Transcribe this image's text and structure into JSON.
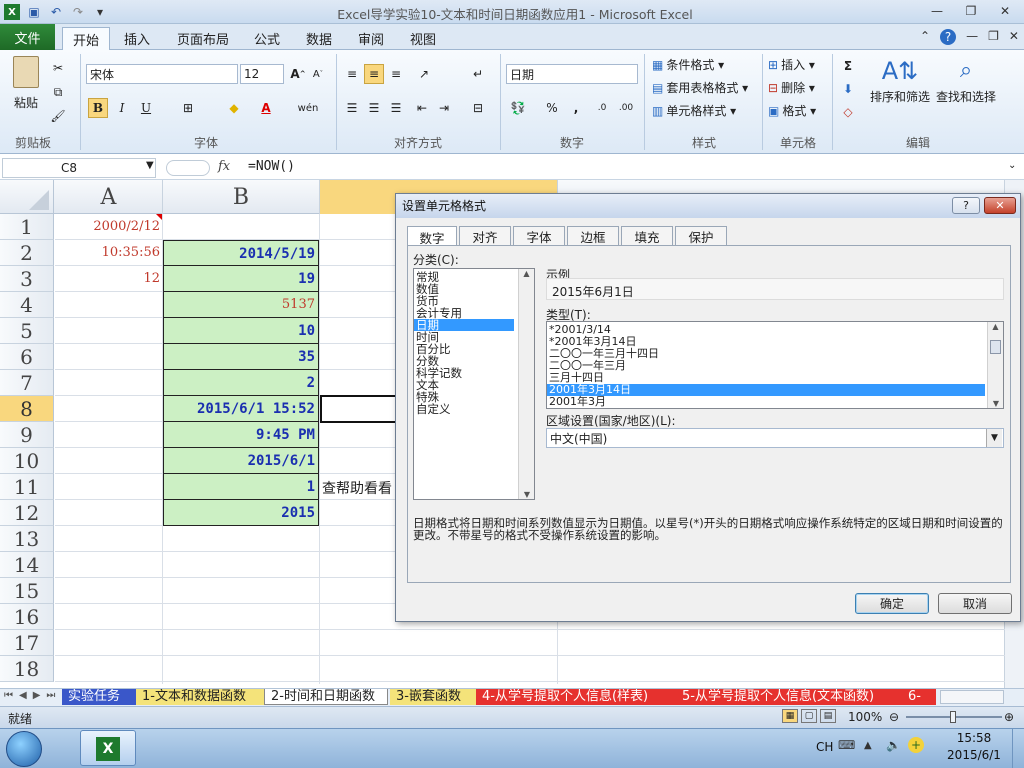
{
  "title_bar": {
    "title": "Excel导学实验10-文本和时间日期函数应用1  -  Microsoft Excel",
    "window_controls": [
      "minimize-icon",
      "restore-icon",
      "close-icon"
    ]
  },
  "ribbon_tabs": {
    "file": "文件",
    "tabs": [
      "开始",
      "插入",
      "页面布局",
      "公式",
      "数据",
      "审阅",
      "视图"
    ],
    "active": "开始"
  },
  "ribbon": {
    "clipboard": {
      "paste": "粘贴",
      "label": "剪贴板"
    },
    "font": {
      "name": "宋体",
      "size": "12",
      "bold": "B",
      "italic": "I",
      "underline": "U",
      "label": "字体"
    },
    "alignment": {
      "label": "对齐方式"
    },
    "number": {
      "format": "日期",
      "percent": "%",
      "comma": ",",
      "label": "数字"
    },
    "styles": {
      "conditional": "条件格式",
      "table": "套用表格格式",
      "cell_styles": "单元格样式",
      "label": "样式"
    },
    "cells": {
      "insert": "插入",
      "delete": "删除",
      "format": "格式",
      "label": "单元格"
    },
    "editing": {
      "sort_filter": "排序和筛选",
      "find_select": "查找和选择",
      "label": "编辑"
    }
  },
  "formula_bar": {
    "name_box": "C8",
    "fx": "fx",
    "formula": "=NOW()"
  },
  "columns": [
    "A",
    "B"
  ],
  "rows": [
    "1",
    "2",
    "3",
    "4",
    "5",
    "6",
    "7",
    "8",
    "9",
    "10",
    "11",
    "12",
    "13",
    "14",
    "15",
    "16",
    "17",
    "18"
  ],
  "selected_row": "8",
  "col_a": [
    "2000/2/12",
    "10:35:56",
    "12"
  ],
  "col_b": [
    "2014/5/19",
    "19",
    "5137",
    "10",
    "35",
    "2",
    "2015/6/1 15:52",
    "9:45 PM",
    "2015/6/1",
    "1",
    "2015"
  ],
  "overflow_text": "查帮助看看",
  "dialog": {
    "title": "设置单元格格式",
    "help": "?",
    "tabs": [
      "数字",
      "对齐",
      "字体",
      "边框",
      "填充",
      "保护"
    ],
    "active_tab": "数字",
    "category_label": "分类(C):",
    "categories": [
      "常规",
      "数值",
      "货币",
      "会计专用",
      "日期",
      "时间",
      "百分比",
      "分数",
      "科学记数",
      "文本",
      "特殊",
      "自定义"
    ],
    "selected_category": "日期",
    "sample_label": "示例",
    "sample_value": "2015年6月1日",
    "type_label": "类型(T):",
    "types": [
      "*2001/3/14",
      "*2001年3月14日",
      "二〇〇一年三月十四日",
      "二〇〇一年三月",
      "三月十四日",
      "2001年3月14日",
      "2001年3月"
    ],
    "selected_type": "2001年3月14日",
    "locale_label": "区域设置(国家/地区)(L):",
    "locale_value": "中文(中国)",
    "description": "日期格式将日期和时间系列数值显示为日期值。以星号(*)开头的日期格式响应操作系统特定的区域日期和时间设置的更改。不带星号的格式不受操作系统设置的影响。",
    "ok": "确定",
    "cancel": "取消"
  },
  "sheet_tabs": [
    "实验任务",
    "1-文本和数据函数",
    "2-时间和日期函数",
    "3-嵌套函数",
    "4-从学号提取个人信息(样表)",
    "5-从学号提取个人信息(文本函数)",
    "6-"
  ],
  "active_sheet": "2-时间和日期函数",
  "status": {
    "ready": "就绪",
    "zoom": "100%"
  },
  "taskbar": {
    "lang": "CH",
    "time": "15:58",
    "date": "2015/6/1"
  },
  "colors": {
    "excel_green": "#1e6a26",
    "cell_fill": "#ccf0c4",
    "cell_text": "#1a2fb0",
    "red_text": "#c0392b",
    "selection_blue": "#3399ff",
    "active_header": "#f9d77e"
  }
}
